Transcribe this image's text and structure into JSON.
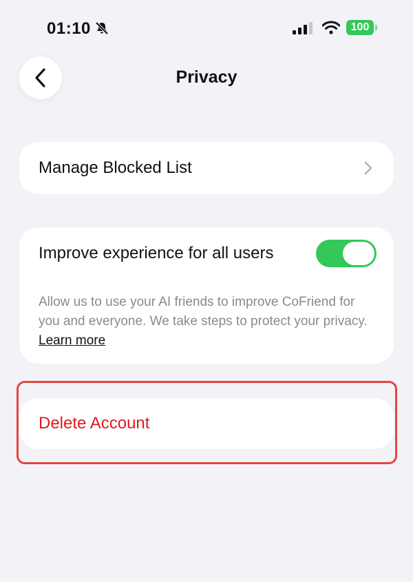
{
  "status_bar": {
    "time": "01:10",
    "battery": "100",
    "battery_color": "#34c759"
  },
  "header": {
    "title": "Privacy",
    "back_icon": "chevron-left-icon"
  },
  "blocked": {
    "label": "Manage Blocked List",
    "icon": "chevron-right-icon"
  },
  "improve": {
    "label": "Improve experience for all users",
    "toggle_on": true,
    "description": "Allow us to use your AI friends to improve CoFriend for you and everyone. We take steps to protect your privacy. ",
    "learn_more": "Learn more"
  },
  "delete": {
    "label": "Delete Account",
    "color": "#e0191f"
  },
  "colors": {
    "background": "#f2f2f7",
    "accent_green": "#34c759",
    "highlight": "#e2463f"
  }
}
